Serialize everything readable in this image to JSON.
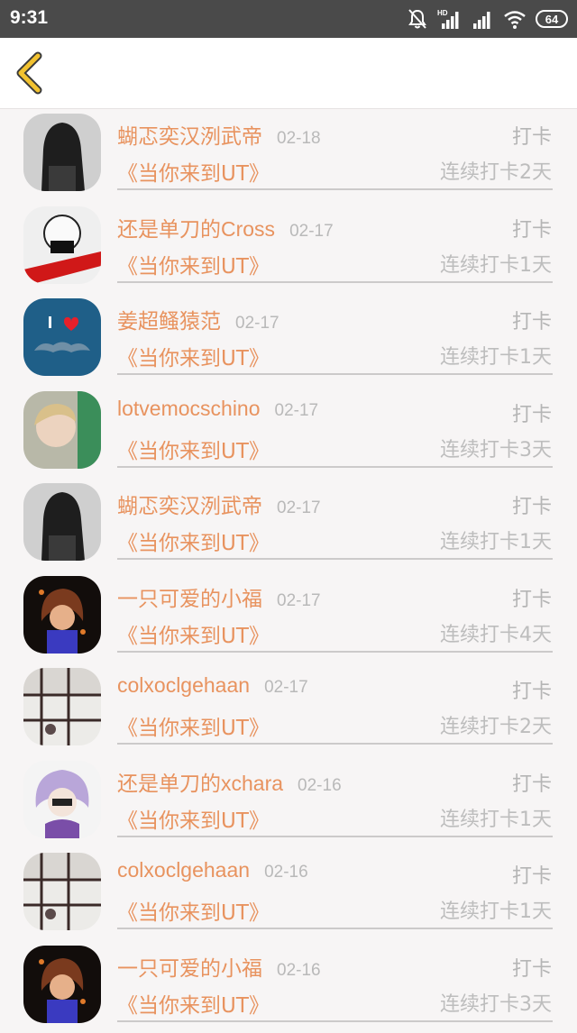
{
  "status_bar": {
    "time": "9:31",
    "battery": "64",
    "network_label": "HD"
  },
  "header": {
    "back_icon": "chevron-left-icon",
    "accent_color": "#f2c230"
  },
  "checkins": [
    {
      "name": "蝴忑奕汉洌武帝",
      "date": "02-18",
      "action": "打卡",
      "book": "《当你来到UT》",
      "streak": "连续打卡2天",
      "avatar": "dark-hair-girl"
    },
    {
      "name": "还是单刀的Cross",
      "date": "02-17",
      "action": "打卡",
      "book": "《当你来到UT》",
      "streak": "连续打卡1天",
      "avatar": "skeleton-character"
    },
    {
      "name": "姜超鳋猿范",
      "date": "02-17",
      "action": "打卡",
      "book": "《当你来到UT》",
      "streak": "连续打卡1天",
      "avatar": "i-love-mustache"
    },
    {
      "name": "lotvemocschino",
      "date": "02-17",
      "action": "打卡",
      "book": "《当你来到UT》",
      "streak": "连续打卡3天",
      "avatar": "blonde-child"
    },
    {
      "name": "蝴忑奕汉洌武帝",
      "date": "02-17",
      "action": "打卡",
      "book": "《当你来到UT》",
      "streak": "连续打卡1天",
      "avatar": "dark-hair-girl"
    },
    {
      "name": "一只可爱的小福",
      "date": "02-17",
      "action": "打卡",
      "book": "《当你来到UT》",
      "streak": "连续打卡4天",
      "avatar": "anime-character-dark"
    },
    {
      "name": "colxoclgehaan",
      "date": "02-17",
      "action": "打卡",
      "book": "《当你来到UT》",
      "streak": "连续打卡2天",
      "avatar": "window-lattice"
    },
    {
      "name": "还是单刀的xchara",
      "date": "02-16",
      "action": "打卡",
      "book": "《当你来到UT》",
      "streak": "连续打卡1天",
      "avatar": "purple-hair-character"
    },
    {
      "name": "colxoclgehaan",
      "date": "02-16",
      "action": "打卡",
      "book": "《当你来到UT》",
      "streak": "连续打卡1天",
      "avatar": "window-lattice"
    },
    {
      "name": "一只可爱的小福",
      "date": "02-16",
      "action": "打卡",
      "book": "《当你来到UT》",
      "streak": "连续打卡3天",
      "avatar": "anime-character-dark"
    }
  ]
}
